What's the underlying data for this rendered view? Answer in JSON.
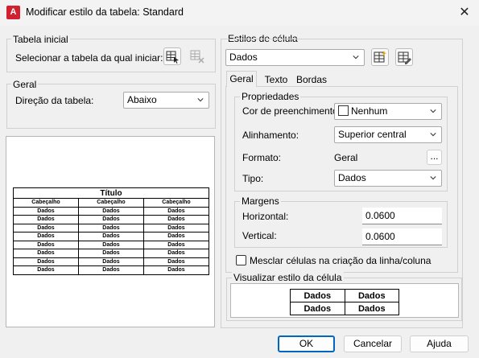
{
  "window": {
    "title": "Modificar estilo da tabela: Standard",
    "app_icon": "A"
  },
  "left": {
    "starting_table": {
      "group_label": "Tabela inicial",
      "select_label": "Selecionar a tabela da qual iniciar:"
    },
    "general": {
      "group_label": "Geral",
      "direction_label": "Direção da tabela:",
      "direction_value": "Abaixo"
    },
    "preview": {
      "title": "Título",
      "headers": [
        "Cabeçalho",
        "Cabeçalho",
        "Cabeçalho"
      ],
      "rows": [
        [
          "Dados",
          "Dados",
          "Dados"
        ],
        [
          "Dados",
          "Dados",
          "Dados"
        ],
        [
          "Dados",
          "Dados",
          "Dados"
        ],
        [
          "Dados",
          "Dados",
          "Dados"
        ],
        [
          "Dados",
          "Dados",
          "Dados"
        ],
        [
          "Dados",
          "Dados",
          "Dados"
        ],
        [
          "Dados",
          "Dados",
          "Dados"
        ],
        [
          "Dados",
          "Dados",
          "Dados"
        ]
      ]
    }
  },
  "right": {
    "cell_styles": {
      "group_label": "Estilos de célula",
      "selected": "Dados"
    },
    "tabs": [
      "Geral",
      "Texto",
      "Bordas"
    ],
    "properties": {
      "group_label": "Propriedades",
      "fill_color_label": "Cor de preenchimento:",
      "fill_color_value": "Nenhum",
      "alignment_label": "Alinhamento:",
      "alignment_value": "Superior central",
      "format_label": "Formato:",
      "format_value": "Geral",
      "format_button": "...",
      "type_label": "Tipo:",
      "type_value": "Dados"
    },
    "margins": {
      "group_label": "Margens",
      "horizontal_label": "Horizontal:",
      "horizontal_value": "0.0600",
      "vertical_label": "Vertical:",
      "vertical_value": "0.0600"
    },
    "merge_label": "Mesclar células na criação da linha/coluna",
    "cell_preview": {
      "group_label": "Visualizar estilo da célula",
      "cells": [
        [
          "Dados",
          "Dados"
        ],
        [
          "Dados",
          "Dados"
        ]
      ]
    }
  },
  "footer": {
    "ok": "OK",
    "cancel": "Cancelar",
    "help": "Ajuda"
  }
}
